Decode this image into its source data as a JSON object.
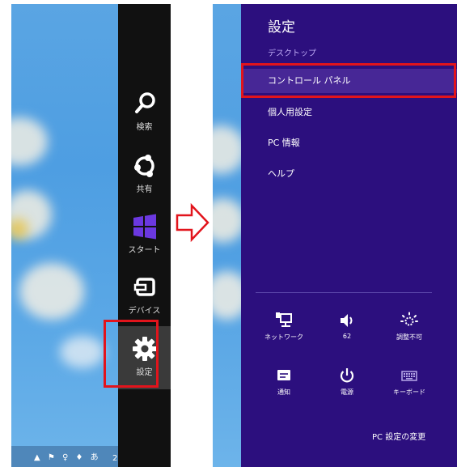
{
  "charms": {
    "search": {
      "label": "検索",
      "icon": "search-icon"
    },
    "share": {
      "label": "共有",
      "icon": "share-icon"
    },
    "start": {
      "label": "スタート",
      "icon": "windows-start-icon"
    },
    "devices": {
      "label": "デバイス",
      "icon": "devices-icon"
    },
    "settings": {
      "label": "設定",
      "icon": "gear-icon"
    }
  },
  "taskbar": {
    "tray_text": "▲ ⚑ ♀ ♦ あ",
    "clock_fragment": "2"
  },
  "settings_pane": {
    "title": "設定",
    "subtitle": "デスクトップ",
    "items": [
      {
        "label": "コントロール パネル"
      },
      {
        "label": "個人用設定"
      },
      {
        "label": "PC 情報"
      },
      {
        "label": "ヘルプ"
      }
    ],
    "quick_settings": [
      {
        "label": "ネットワーク",
        "icon": "network-icon"
      },
      {
        "label": "62",
        "icon": "volume-icon"
      },
      {
        "label": "調整不可",
        "icon": "brightness-icon"
      },
      {
        "label": "通知",
        "icon": "notifications-icon"
      },
      {
        "label": "電源",
        "icon": "power-icon"
      },
      {
        "label": "キーボード",
        "icon": "keyboard-icon"
      }
    ],
    "pc_settings_link": "PC 設定の変更"
  },
  "colors": {
    "charms_bar": "#111111",
    "settings_pane": "#2c0f7e",
    "start_tile": "#6b38e0",
    "highlight": "#e2141c",
    "desktop": "#4e9ee2"
  }
}
